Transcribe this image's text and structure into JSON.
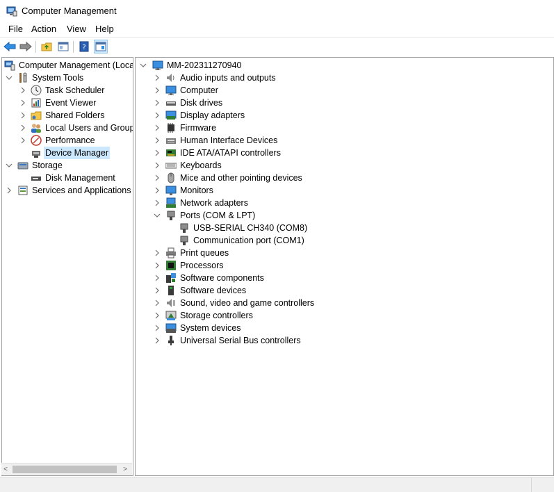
{
  "window": {
    "title": "Computer Management"
  },
  "menu": [
    "File",
    "Action",
    "View",
    "Help"
  ],
  "left_tree": [
    {
      "label": "Computer Management (Local",
      "icon": "computer-management-icon"
    },
    {
      "label": "System Tools",
      "icon": "tools-icon"
    },
    {
      "label": "Task Scheduler",
      "icon": "clock-icon"
    },
    {
      "label": "Event Viewer",
      "icon": "event-viewer-icon"
    },
    {
      "label": "Shared Folders",
      "icon": "shared-folder-icon"
    },
    {
      "label": "Local Users and Groups",
      "icon": "users-icon"
    },
    {
      "label": "Performance",
      "icon": "performance-icon"
    },
    {
      "label": "Device Manager",
      "icon": "device-manager-icon",
      "selected": true
    },
    {
      "label": "Storage",
      "icon": "storage-icon"
    },
    {
      "label": "Disk Management",
      "icon": "disk-management-icon"
    },
    {
      "label": "Services and Applications",
      "icon": "services-icon"
    }
  ],
  "device_tree": {
    "root": "MM-202311270940",
    "categories": [
      {
        "label": "Audio inputs and outputs",
        "icon": "speaker-icon"
      },
      {
        "label": "Computer",
        "icon": "computer-icon"
      },
      {
        "label": "Disk drives",
        "icon": "disk-drive-icon"
      },
      {
        "label": "Display adapters",
        "icon": "display-adapter-icon"
      },
      {
        "label": "Firmware",
        "icon": "chip-icon"
      },
      {
        "label": "Human Interface Devices",
        "icon": "hid-icon"
      },
      {
        "label": "IDE ATA/ATAPI controllers",
        "icon": "ide-controller-icon"
      },
      {
        "label": "Keyboards",
        "icon": "keyboard-icon"
      },
      {
        "label": "Mice and other pointing devices",
        "icon": "mouse-icon"
      },
      {
        "label": "Monitors",
        "icon": "monitor-icon"
      },
      {
        "label": "Network adapters",
        "icon": "network-icon"
      },
      {
        "label": "Ports (COM & LPT)",
        "icon": "port-icon",
        "expanded": true,
        "children": [
          "USB-SERIAL CH340 (COM8)",
          "Communication port (COM1)"
        ]
      },
      {
        "label": "Print queues",
        "icon": "printer-icon"
      },
      {
        "label": "Processors",
        "icon": "processor-icon"
      },
      {
        "label": "Software components",
        "icon": "software-component-icon"
      },
      {
        "label": "Software devices",
        "icon": "software-device-icon"
      },
      {
        "label": "Sound, video and game controllers",
        "icon": "sound-icon"
      },
      {
        "label": "Storage controllers",
        "icon": "storage-controller-icon"
      },
      {
        "label": "System devices",
        "icon": "system-devices-icon"
      },
      {
        "label": "Universal Serial Bus controllers",
        "icon": "usb-icon"
      }
    ]
  },
  "colors": {
    "selection": "#cce8ff",
    "accent": "#0078d7"
  }
}
